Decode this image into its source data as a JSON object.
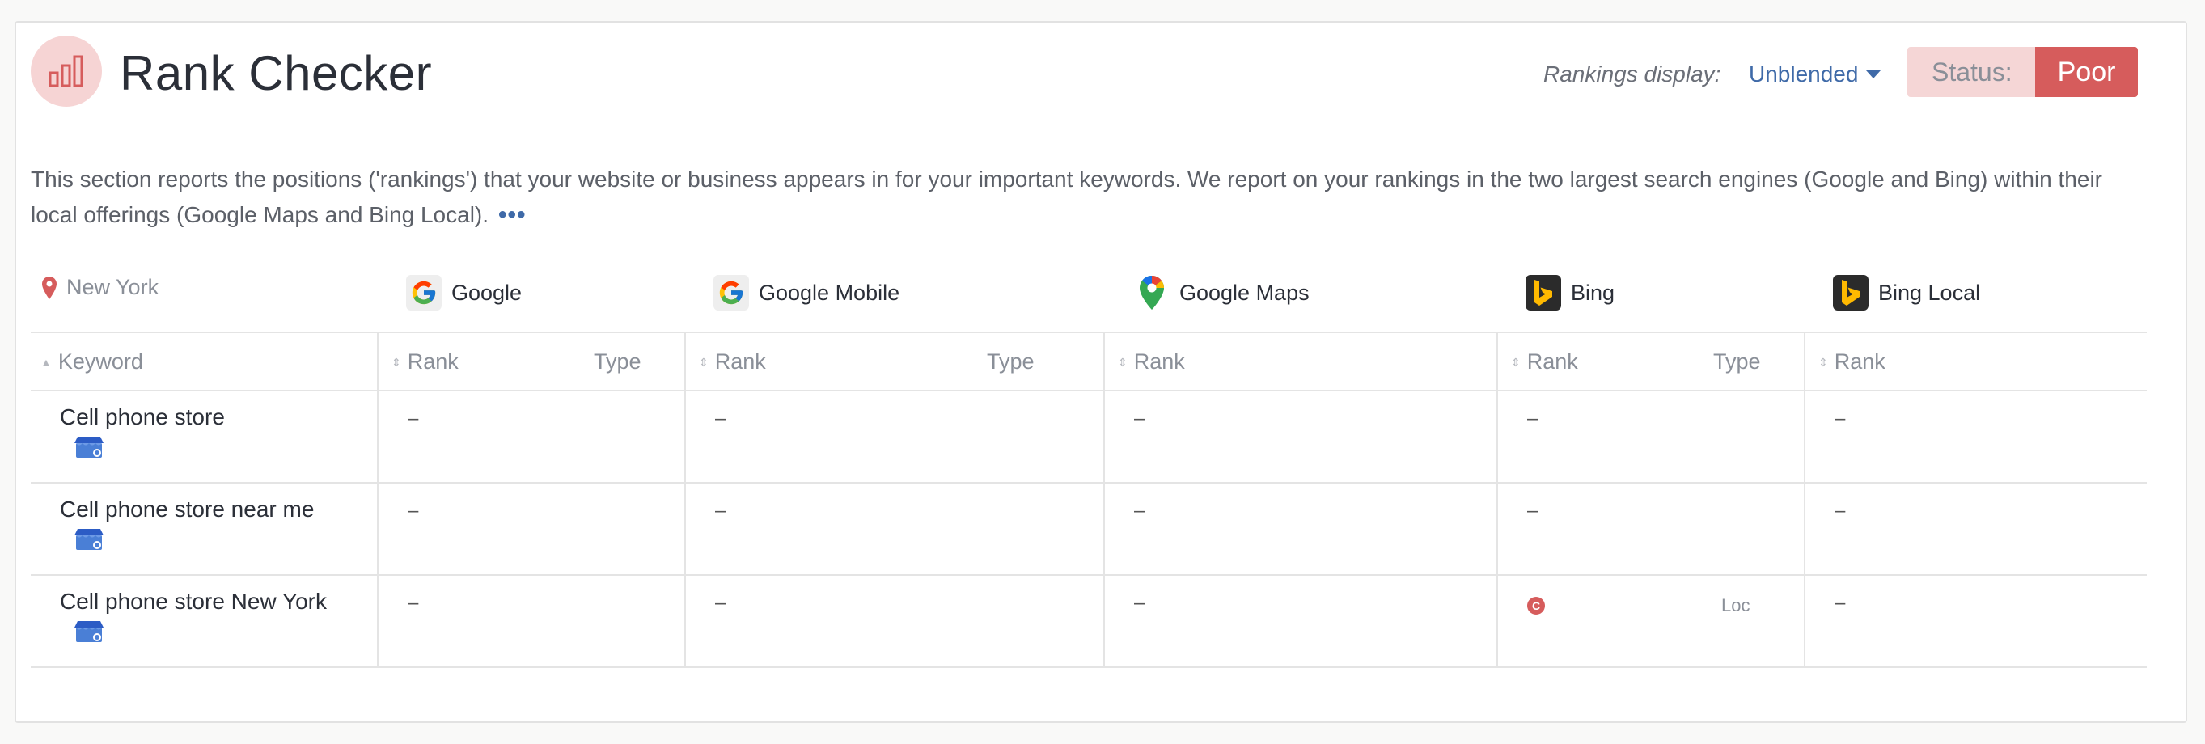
{
  "header": {
    "title": "Rank Checker",
    "rankings_display_label": "Rankings display:",
    "rankings_display_value": "Unblended",
    "status_label": "Status:",
    "status_value": "Poor"
  },
  "description": "This section reports the positions ('rankings') that your website or business appears in for your important keywords. We report on your rankings in the two largest search engines (Google and Bing) within their local offerings (Google Maps and Bing Local).",
  "more_label": "•••",
  "location": "New York",
  "engines": [
    {
      "name": "Google",
      "icon": "google-icon"
    },
    {
      "name": "Google Mobile",
      "icon": "google-icon"
    },
    {
      "name": "Google Maps",
      "icon": "google-maps-icon"
    },
    {
      "name": "Bing",
      "icon": "bing-icon"
    },
    {
      "name": "Bing Local",
      "icon": "bing-icon"
    }
  ],
  "columns": {
    "keyword": "Keyword",
    "rank": "Rank",
    "type": "Type"
  },
  "rows": [
    {
      "keyword": "Cell phone store",
      "google": "–",
      "google_mobile": "–",
      "google_maps": "–",
      "bing": "–",
      "bing_type": "",
      "bing_local": "–"
    },
    {
      "keyword": "Cell phone store near me",
      "google": "–",
      "google_mobile": "–",
      "google_maps": "–",
      "bing": "–",
      "bing_type": "",
      "bing_local": "–"
    },
    {
      "keyword": "Cell phone store New York",
      "google": "–",
      "google_mobile": "–",
      "google_maps": "–",
      "bing": "C",
      "bing_type": "Loc",
      "bing_local": "–"
    }
  ],
  "colors": {
    "accent": "#3f6aa8",
    "status_poor": "#d65c5c",
    "status_bg": "#f5d6d6"
  }
}
